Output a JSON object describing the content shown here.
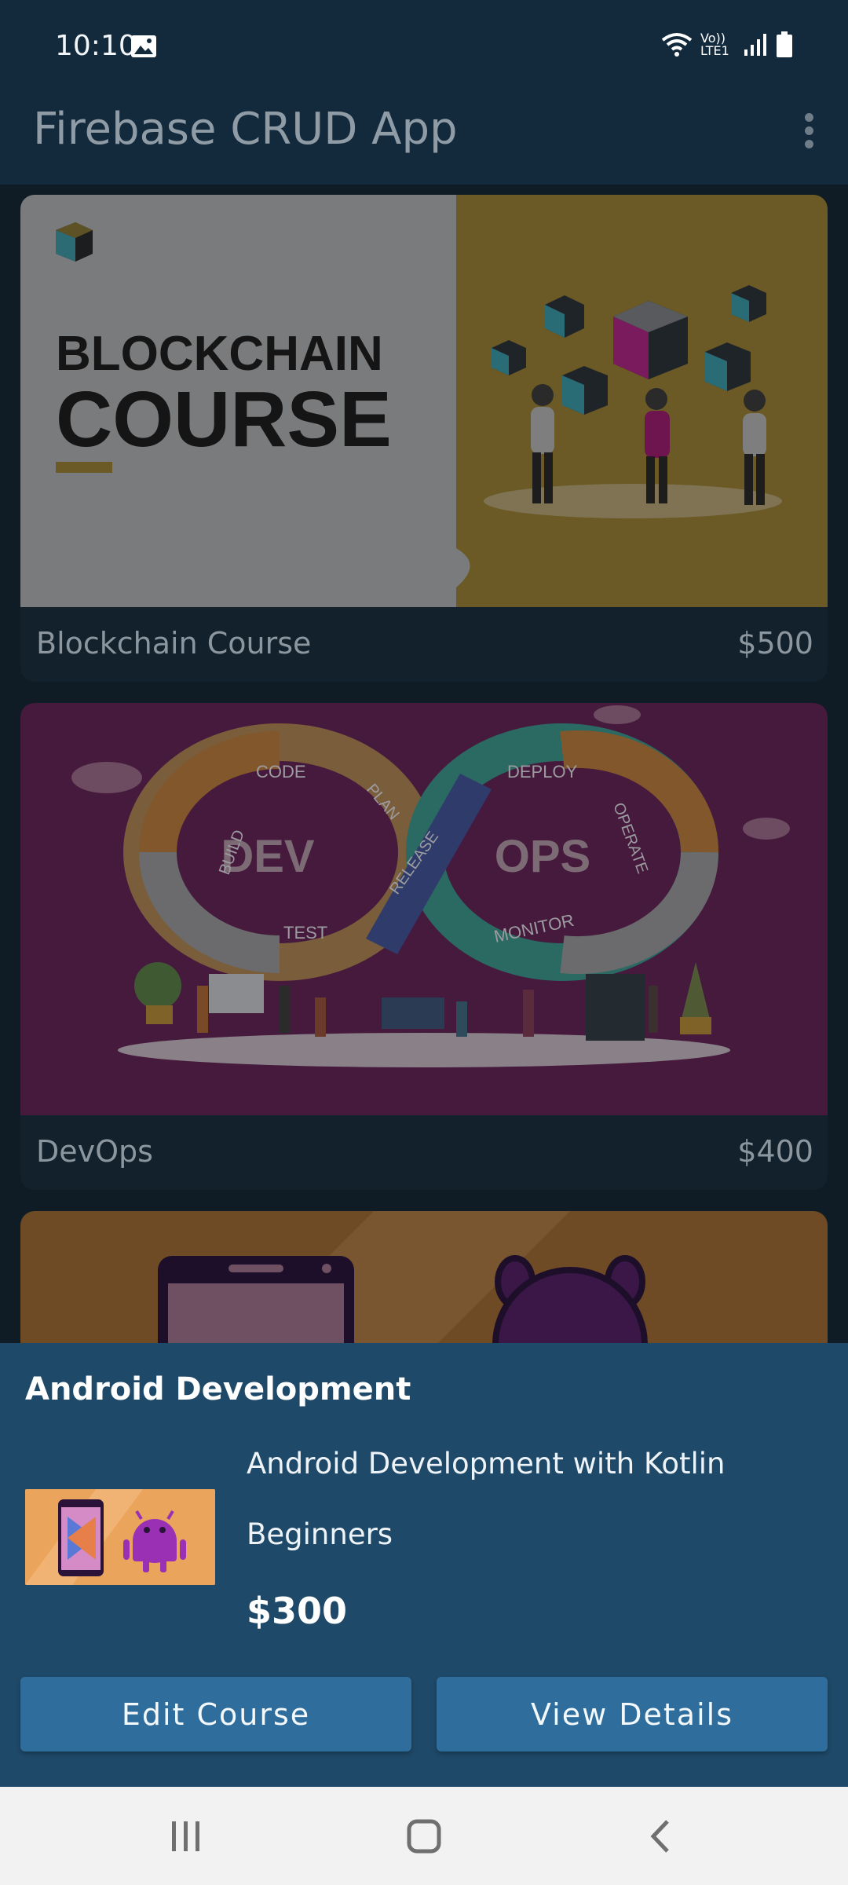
{
  "status_bar": {
    "time": "10:10",
    "network_label": "Vo)) LTE1",
    "icons": [
      "image-icon",
      "wifi-icon",
      "signal-icon",
      "battery-icon"
    ]
  },
  "app_bar": {
    "title": "Firebase CRUD App",
    "menu_icon": "overflow-menu-icon"
  },
  "courses": [
    {
      "name": "Blockchain  Course",
      "price": "$500",
      "image_text": {
        "line1": "BLOCKCHAIN",
        "line2": "COURSE"
      }
    },
    {
      "name": "DevOps",
      "price": "$400",
      "image_text": {
        "left": "DEV",
        "right": "OPS",
        "labels": [
          "CODE",
          "PLAN",
          "BUILD",
          "TEST",
          "RELEASE",
          "DEPLOY",
          "OPERATE",
          "MONITOR"
        ]
      }
    },
    {
      "name": "",
      "price": ""
    }
  ],
  "bottom_sheet": {
    "title": "Android Development",
    "description": "Android Development with Kotlin",
    "level": "Beginners",
    "price": "$300",
    "edit_button": "Edit Course",
    "view_button": "View Details"
  },
  "nav_bar": {
    "items": [
      "recents-icon",
      "home-icon",
      "back-icon"
    ]
  },
  "colors": {
    "app_bar": "#132a3d",
    "sheet": "#1f4968",
    "button": "#2f6d9c"
  }
}
